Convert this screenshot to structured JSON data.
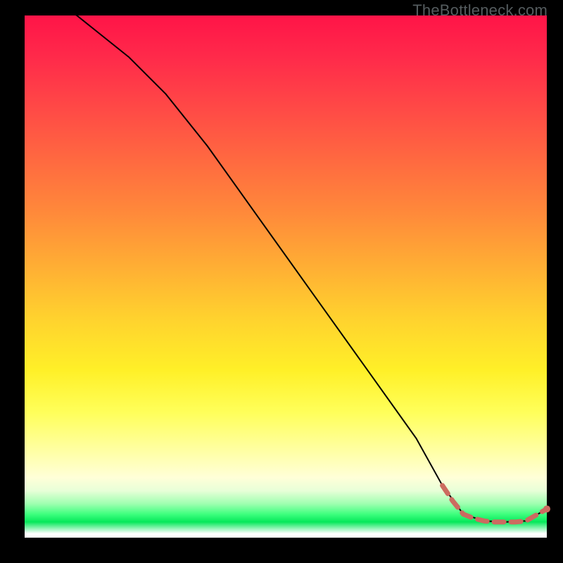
{
  "watermark": "TheBottleneck.com",
  "colors": {
    "line": "#000000",
    "marker": "#cc6b60",
    "background_black": "#000000"
  },
  "chart_data": {
    "type": "line",
    "title": "",
    "xlabel": "",
    "ylabel": "",
    "xlim": [
      0,
      100
    ],
    "ylim": [
      0,
      100
    ],
    "series": [
      {
        "name": "bottleneck-curve",
        "x": [
          0,
          10,
          20,
          27,
          35,
          45,
          55,
          65,
          75,
          80,
          84,
          88,
          92,
          96,
          100
        ],
        "y": [
          107,
          100,
          92,
          85,
          75,
          61,
          47,
          33,
          19,
          10,
          4.5,
          3.2,
          3.0,
          3.2,
          5.5
        ]
      }
    ],
    "markers": {
      "name": "highlight-segment",
      "x": [
        80,
        82,
        84,
        86,
        88,
        90,
        92,
        94,
        96,
        100
      ],
      "y": [
        10,
        7,
        4.5,
        3.7,
        3.2,
        3.0,
        3.0,
        3.0,
        3.2,
        5.5
      ]
    },
    "end_dot": {
      "x": 100,
      "y": 5.5
    }
  }
}
